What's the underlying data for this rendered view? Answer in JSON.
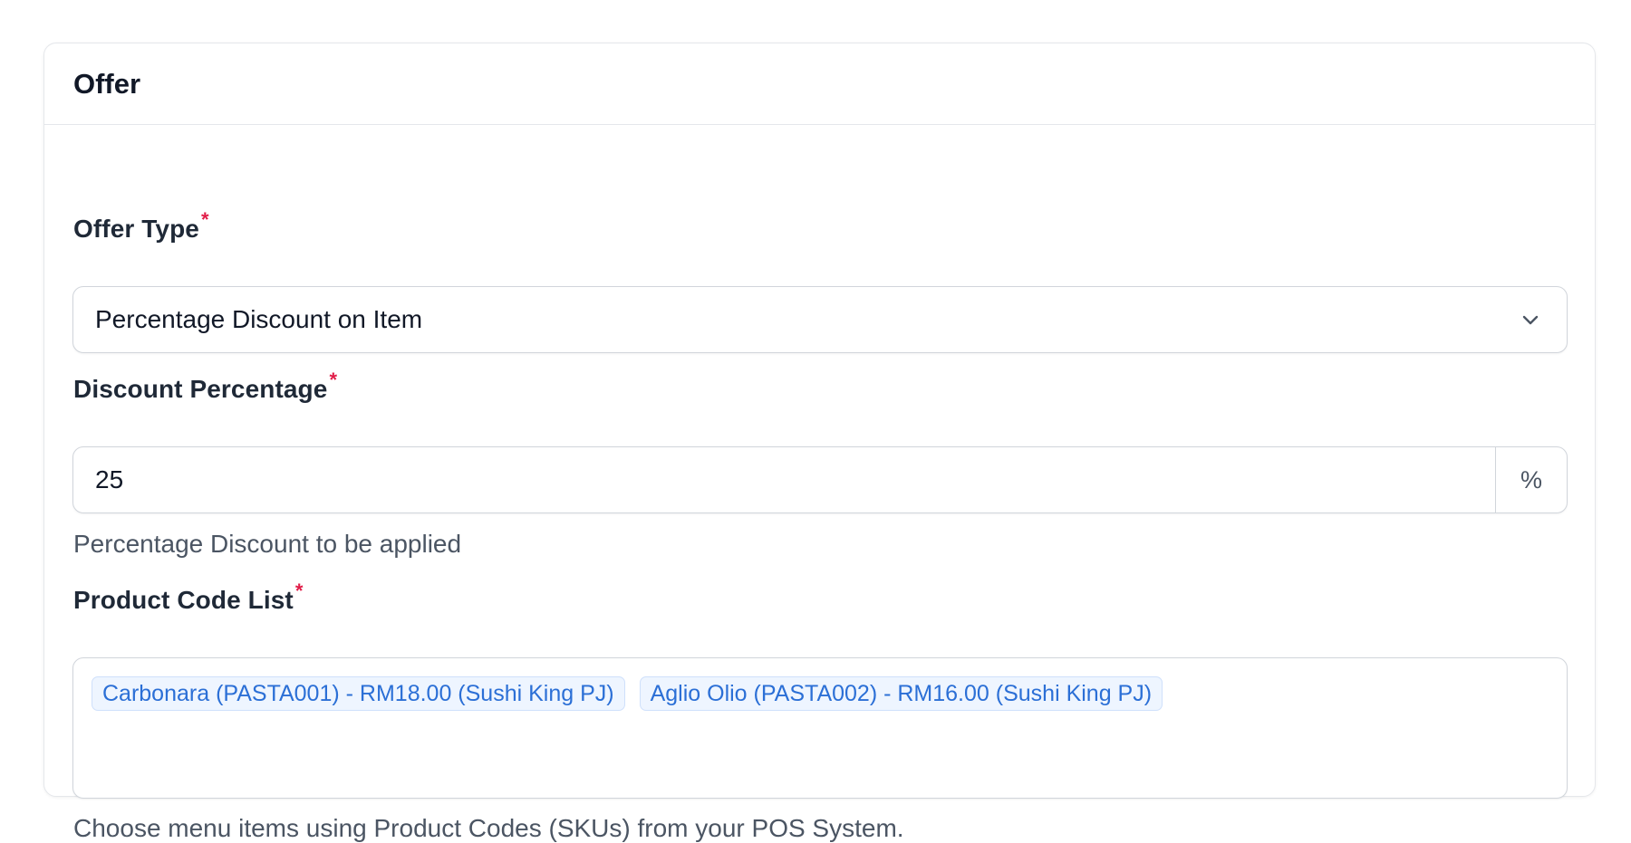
{
  "card": {
    "title": "Offer"
  },
  "offer_type": {
    "label": "Offer Type",
    "required_mark": "*",
    "selected": "Percentage Discount on Item",
    "icon": "chevron-down-icon"
  },
  "discount_percentage": {
    "label": "Discount Percentage",
    "required_mark": "*",
    "value": "25",
    "suffix": "%",
    "help": "Percentage Discount to be applied"
  },
  "product_code_list": {
    "label": "Product Code List",
    "required_mark": "*",
    "tags": [
      {
        "text": "Carbonara (PASTA001) - RM18.00 (Sushi King PJ)"
      },
      {
        "text": "Aglio Olio (PASTA002) - RM16.00 (Sushi King PJ)"
      }
    ],
    "help": "Choose menu items using Product Codes (SKUs) from your POS System."
  },
  "colors": {
    "required": "#e11d48",
    "tag_text": "#2b6fd6",
    "tag_bg": "#eef5ff",
    "border": "#d1d5db"
  }
}
